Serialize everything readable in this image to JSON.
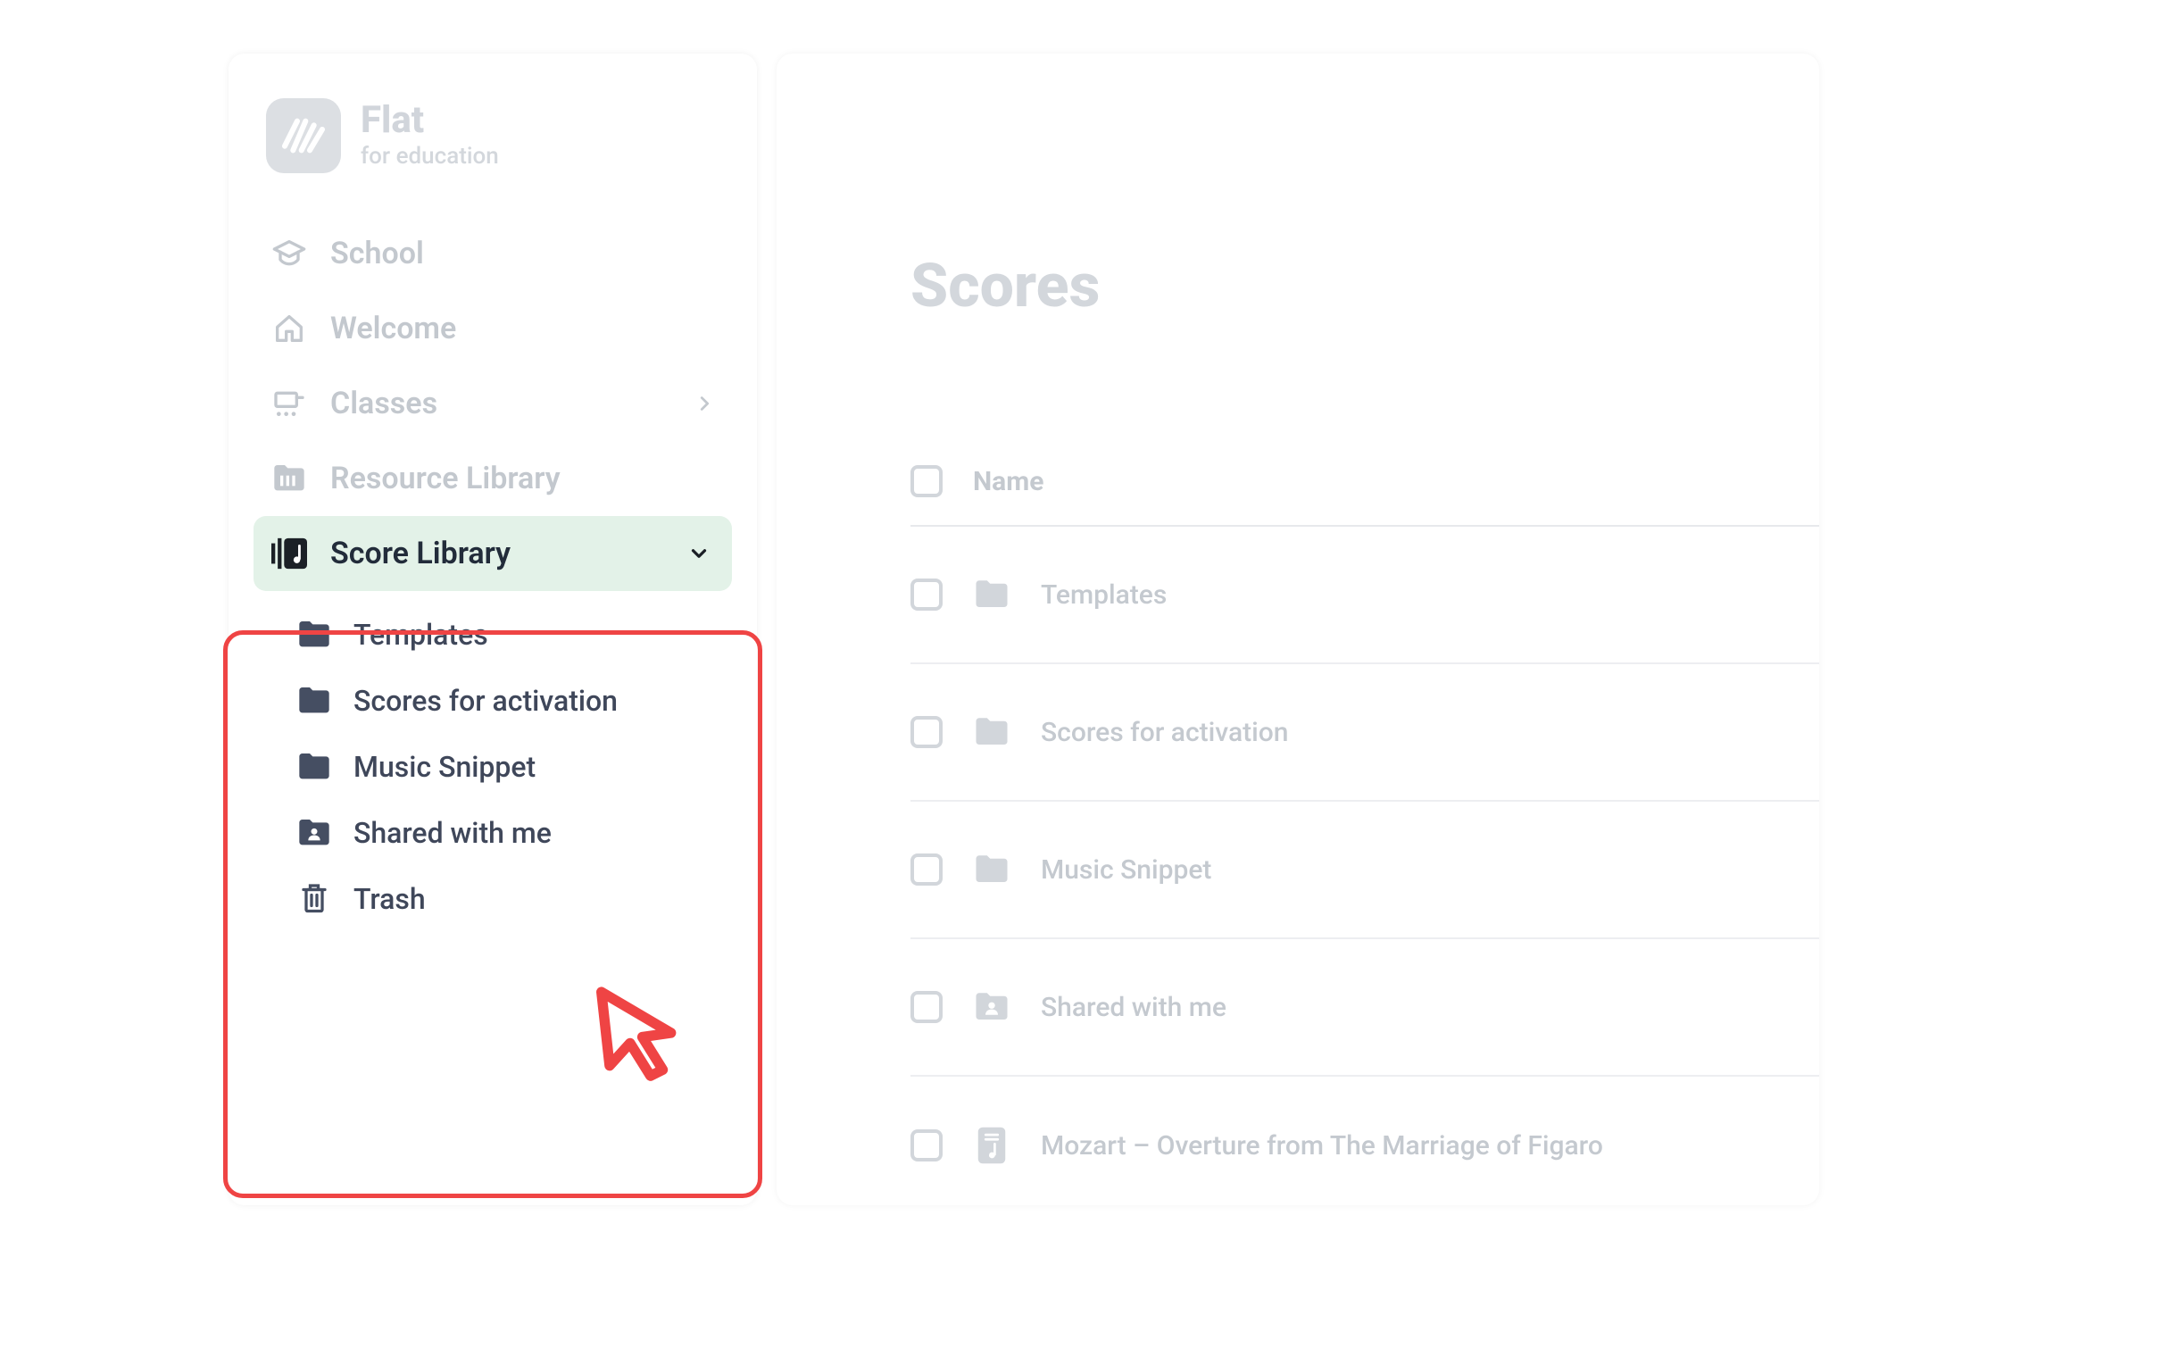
{
  "brand": {
    "name": "Flat",
    "tagline": "for education"
  },
  "sidebar": {
    "items": [
      {
        "label": "School"
      },
      {
        "label": "Welcome"
      },
      {
        "label": "Classes"
      },
      {
        "label": "Resource Library"
      },
      {
        "label": "Score Library"
      }
    ],
    "score_library_children": [
      {
        "label": "Templates"
      },
      {
        "label": "Scores for activation"
      },
      {
        "label": "Music Snippet"
      },
      {
        "label": "Shared with me"
      },
      {
        "label": "Trash"
      }
    ]
  },
  "main": {
    "title": "Scores",
    "columns": {
      "name": "Name"
    },
    "rows": [
      {
        "label": "Templates",
        "icon": "folder"
      },
      {
        "label": "Scores for activation",
        "icon": "folder"
      },
      {
        "label": "Music Snippet",
        "icon": "folder"
      },
      {
        "label": "Shared with me",
        "icon": "shared-folder"
      },
      {
        "label": "Mozart – Overture from The Marriage of Figaro",
        "icon": "score"
      }
    ]
  }
}
